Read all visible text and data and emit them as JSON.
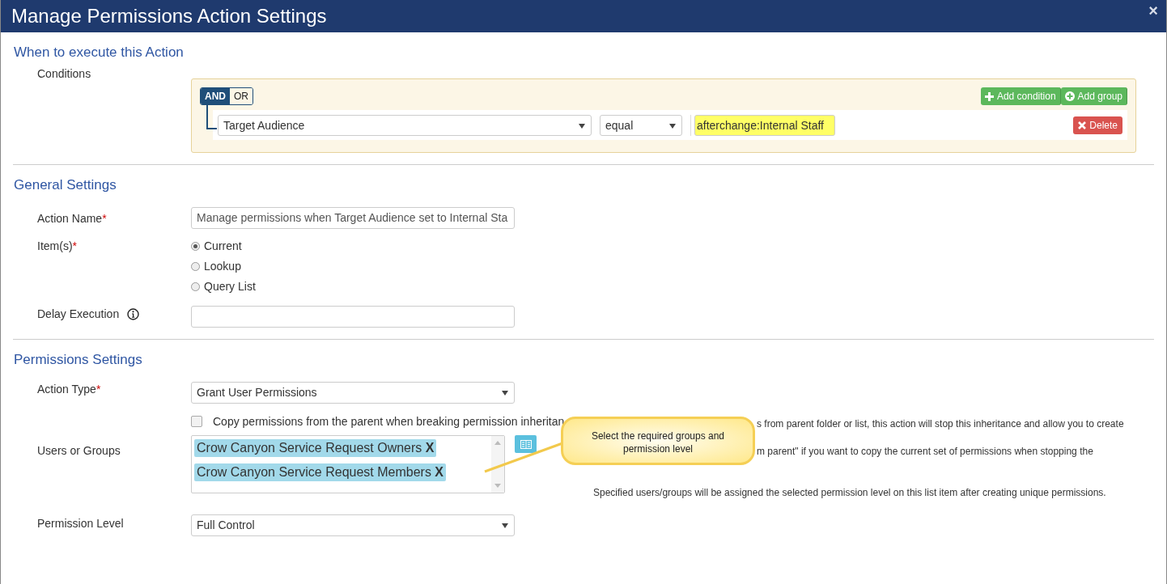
{
  "window": {
    "title": "Manage Permissions Action Settings",
    "close": "×"
  },
  "when": {
    "heading": "When to execute this Action",
    "label": "Conditions",
    "logic": [
      {
        "label": "AND",
        "selected": true
      },
      {
        "label": "OR",
        "selected": false
      }
    ],
    "add_buttons": [
      {
        "kind": "plus",
        "label": "Add condition"
      },
      {
        "kind": "circle",
        "label": "Add group"
      }
    ],
    "rule": {
      "field": "Target Audience",
      "operator": "equal",
      "value": "afterchange:Internal Staff",
      "delete": "Delete"
    }
  },
  "general": {
    "heading": "General Settings",
    "action_name": {
      "label": "Action Name",
      "marker": "*",
      "value": "Manage permissions when Target Audience set to Internal Sta"
    },
    "items": {
      "label": "Item(s)",
      "marker": "*",
      "options": [
        {
          "label": "Current",
          "selected": true
        },
        {
          "label": "Lookup",
          "selected": false
        },
        {
          "label": "Query List",
          "selected": false
        }
      ]
    },
    "delay": {
      "label": "Delay Execution"
    }
  },
  "permissions": {
    "heading": "Permissions Settings",
    "action_type": {
      "label": "Action Type",
      "marker": "*",
      "value": "Grant User Permissions"
    },
    "copy": {
      "label": "Copy permissions from the parent when breaking permission inheritan",
      "checked": false
    },
    "users": {
      "label": "Users or Groups",
      "tags": [
        {
          "name": "Crow Canyon Service Request Owners",
          "remove": "X"
        },
        {
          "name": "Crow Canyon Service Request Members",
          "remove": "X"
        }
      ]
    },
    "level": {
      "label": "Permission Level",
      "value": "Full Control"
    },
    "help": [
      "s from parent folder or list, this action will stop this inheritance and allow you to create",
      "m parent\" if you want to copy the current set of permissions when stopping the",
      "Specified users/groups will be assigned the selected permission level on this list item after creating unique permissions."
    ]
  },
  "callout": {
    "text": "Select the required groups and permission level"
  }
}
